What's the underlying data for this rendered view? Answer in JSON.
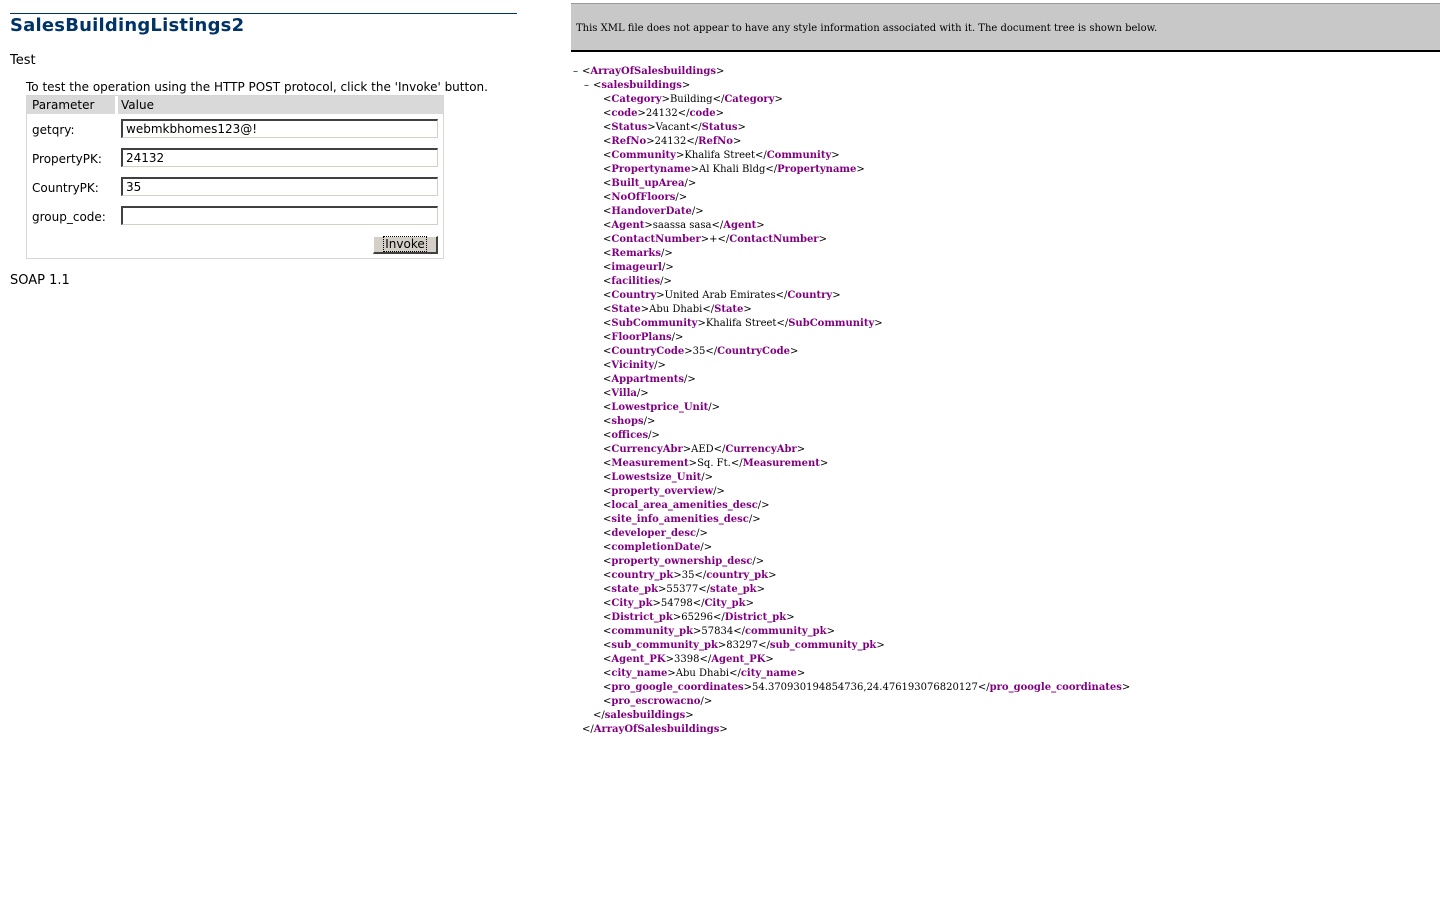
{
  "service": {
    "title": "SalesBuildingListings2",
    "test_heading": "Test",
    "instructions": "To test the operation using the HTTP POST protocol, click the 'Invoke' button.",
    "table_header": {
      "parameter": "Parameter",
      "value": "Value"
    },
    "params": [
      {
        "label": "getqry:",
        "value": "webmkbhomes123@!"
      },
      {
        "label": "PropertyPK:",
        "value": "24132"
      },
      {
        "label": "CountryPK:",
        "value": "35"
      },
      {
        "label": "group_code:",
        "value": ""
      }
    ],
    "invoke_label": "Invoke",
    "soap_heading": "SOAP 1.1"
  },
  "xml_viewer": {
    "banner": "This XML file does not appear to have any style information associated with it. The document tree is shown below.",
    "collapse_symbol": "–",
    "root_tag": "ArrayOfSalesbuildings",
    "item_tag": "salesbuildings",
    "elements": [
      {
        "tag": "Category",
        "text": "Building"
      },
      {
        "tag": "code",
        "text": "24132"
      },
      {
        "tag": "Status",
        "text": "Vacant"
      },
      {
        "tag": "RefNo",
        "text": "24132"
      },
      {
        "tag": "Community",
        "text": "Khalifa Street"
      },
      {
        "tag": "Propertyname",
        "text": "Al Khali Bldg"
      },
      {
        "tag": "Built_upArea"
      },
      {
        "tag": "NoOfFloors"
      },
      {
        "tag": "HandoverDate"
      },
      {
        "tag": "Agent",
        "text": "saassa sasa"
      },
      {
        "tag": "ContactNumber",
        "text": "+"
      },
      {
        "tag": "Remarks"
      },
      {
        "tag": "imageurl"
      },
      {
        "tag": "facilities"
      },
      {
        "tag": "Country",
        "text": "United Arab Emirates"
      },
      {
        "tag": "State",
        "text": "Abu Dhabi"
      },
      {
        "tag": "SubCommunity",
        "text": "Khalifa Street"
      },
      {
        "tag": "FloorPlans"
      },
      {
        "tag": "CountryCode",
        "text": "35"
      },
      {
        "tag": "Vicinity"
      },
      {
        "tag": "Appartments"
      },
      {
        "tag": "Villa"
      },
      {
        "tag": "Lowestprice_Unit"
      },
      {
        "tag": "shops"
      },
      {
        "tag": "offices"
      },
      {
        "tag": "CurrencyAbr",
        "text": "AED"
      },
      {
        "tag": "Measurement",
        "text": "Sq. Ft."
      },
      {
        "tag": "Lowestsize_Unit"
      },
      {
        "tag": "property_overview"
      },
      {
        "tag": "local_area_amenities_desc"
      },
      {
        "tag": "site_info_amenities_desc"
      },
      {
        "tag": "developer_desc"
      },
      {
        "tag": "completionDate"
      },
      {
        "tag": "property_ownership_desc"
      },
      {
        "tag": "country_pk",
        "text": "35"
      },
      {
        "tag": "state_pk",
        "text": "55377"
      },
      {
        "tag": "City_pk",
        "text": "54798"
      },
      {
        "tag": "District_pk",
        "text": "65296"
      },
      {
        "tag": "community_pk",
        "text": "57834"
      },
      {
        "tag": "sub_community_pk",
        "text": "83297"
      },
      {
        "tag": "Agent_PK",
        "text": "3398"
      },
      {
        "tag": "city_name",
        "text": "Abu Dhabi"
      },
      {
        "tag": "pro_google_coordinates",
        "text": "54.370930194854736,24.476193076820127"
      },
      {
        "tag": "pro_escrowacno"
      }
    ]
  }
}
